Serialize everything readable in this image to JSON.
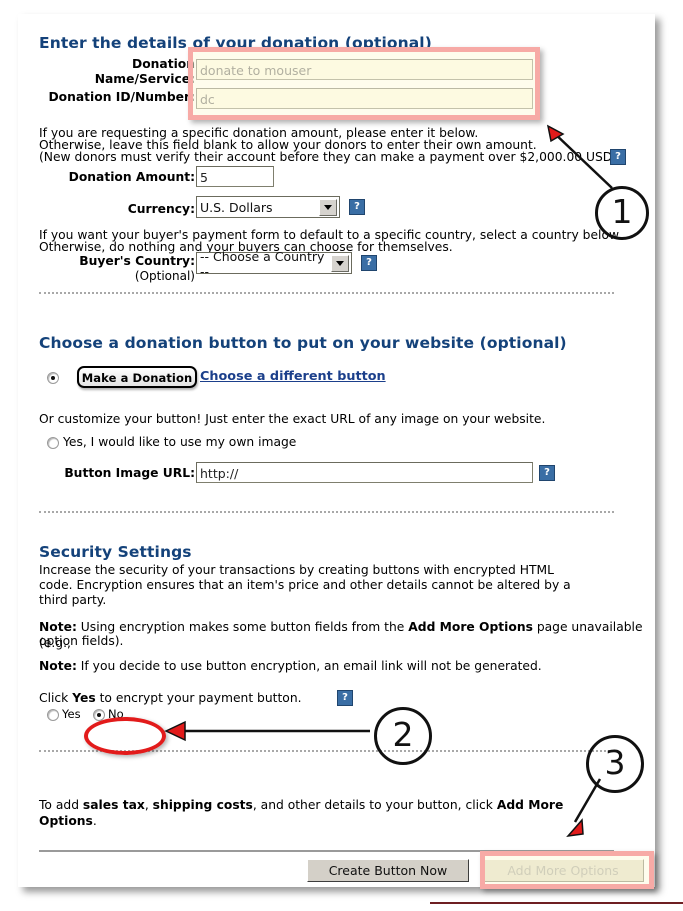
{
  "sections": {
    "donation_details": {
      "heading": "Enter the details of your donation (optional)",
      "fields": {
        "name_label_line1": "Donation",
        "name_label_line2": "Name/Service:",
        "name_value": "donate to mouser",
        "id_label": "Donation ID/Number:",
        "id_value": "dc",
        "amount_label": "Donation Amount:",
        "amount_value": "5",
        "currency_label": "Currency:",
        "currency_value": "U.S. Dollars",
        "country_label": "Buyer's Country:",
        "country_sublabel": "(Optional)",
        "country_value": "-- Choose a Country --"
      },
      "help_text_line1": "If you are requesting a specific donation amount, please enter it below.",
      "help_text_line2": "Otherwise, leave this field blank to allow your donors to enter their own amount.",
      "help_text_line3": "(New donors must verify their account before they can make a payment over $2,000.00 USD)",
      "country_text_line1": "If you want your buyer's payment form to default to a specific country, select a country below.",
      "country_text_line2": "Otherwise, do nothing and your buyers can choose for themselves."
    },
    "donation_button": {
      "heading": "Choose a donation button to put on your website (optional)",
      "make_donation_label": "Make a Donation",
      "choose_different_link": "Choose a different button",
      "customize_text": "Or customize your button! Just enter the exact URL of any image on your website.",
      "own_image_label": "Yes, I would like to use my own image",
      "image_url_label": "Button Image URL:",
      "image_url_value": "http://"
    },
    "security": {
      "heading": "Security Settings",
      "intro_line1": "Increase the security of your transactions by creating buttons with encrypted HTML",
      "intro_line2": "code. Encryption ensures that an item's price and other details cannot be altered by a",
      "intro_line3": "third party.",
      "note1_prefix": "Note:",
      "note1_a": " Using encryption makes some button fields from the ",
      "note1_bold": "Add More Options",
      "note1_b": " page unavailable (e.g.,",
      "note1_line2": "option fields).",
      "note2_prefix": "Note:",
      "note2_text": " If you decide to use button encryption, an email link will not be generated.",
      "prompt_pre": "Click ",
      "prompt_bold": "Yes",
      "prompt_post": " to encrypt your payment button.",
      "yes_label": "Yes",
      "no_label": "No",
      "selected": "No"
    },
    "footer": {
      "text_pre": "To add ",
      "text_b1": "sales tax",
      "text_mid1": ", ",
      "text_b2": "shipping costs",
      "text_mid2": ", and other details to your button, click ",
      "text_b3": "Add More",
      "text_b4": "Options",
      "text_end": ".",
      "create_button_label": "Create Button Now",
      "add_more_options_label": "Add More Options"
    }
  },
  "annotations": {
    "marker1": "1",
    "marker2": "2",
    "marker3": "3"
  },
  "icons": {
    "help": "?"
  },
  "colors": {
    "heading_blue": "#14427a",
    "link_blue": "#1b3f8b",
    "highlight_pink": "#f7aaa6",
    "highlight_cream": "#fcfbe4",
    "annotation_red": "#e21b1b",
    "help_icon_blue": "#3a6ea5"
  }
}
